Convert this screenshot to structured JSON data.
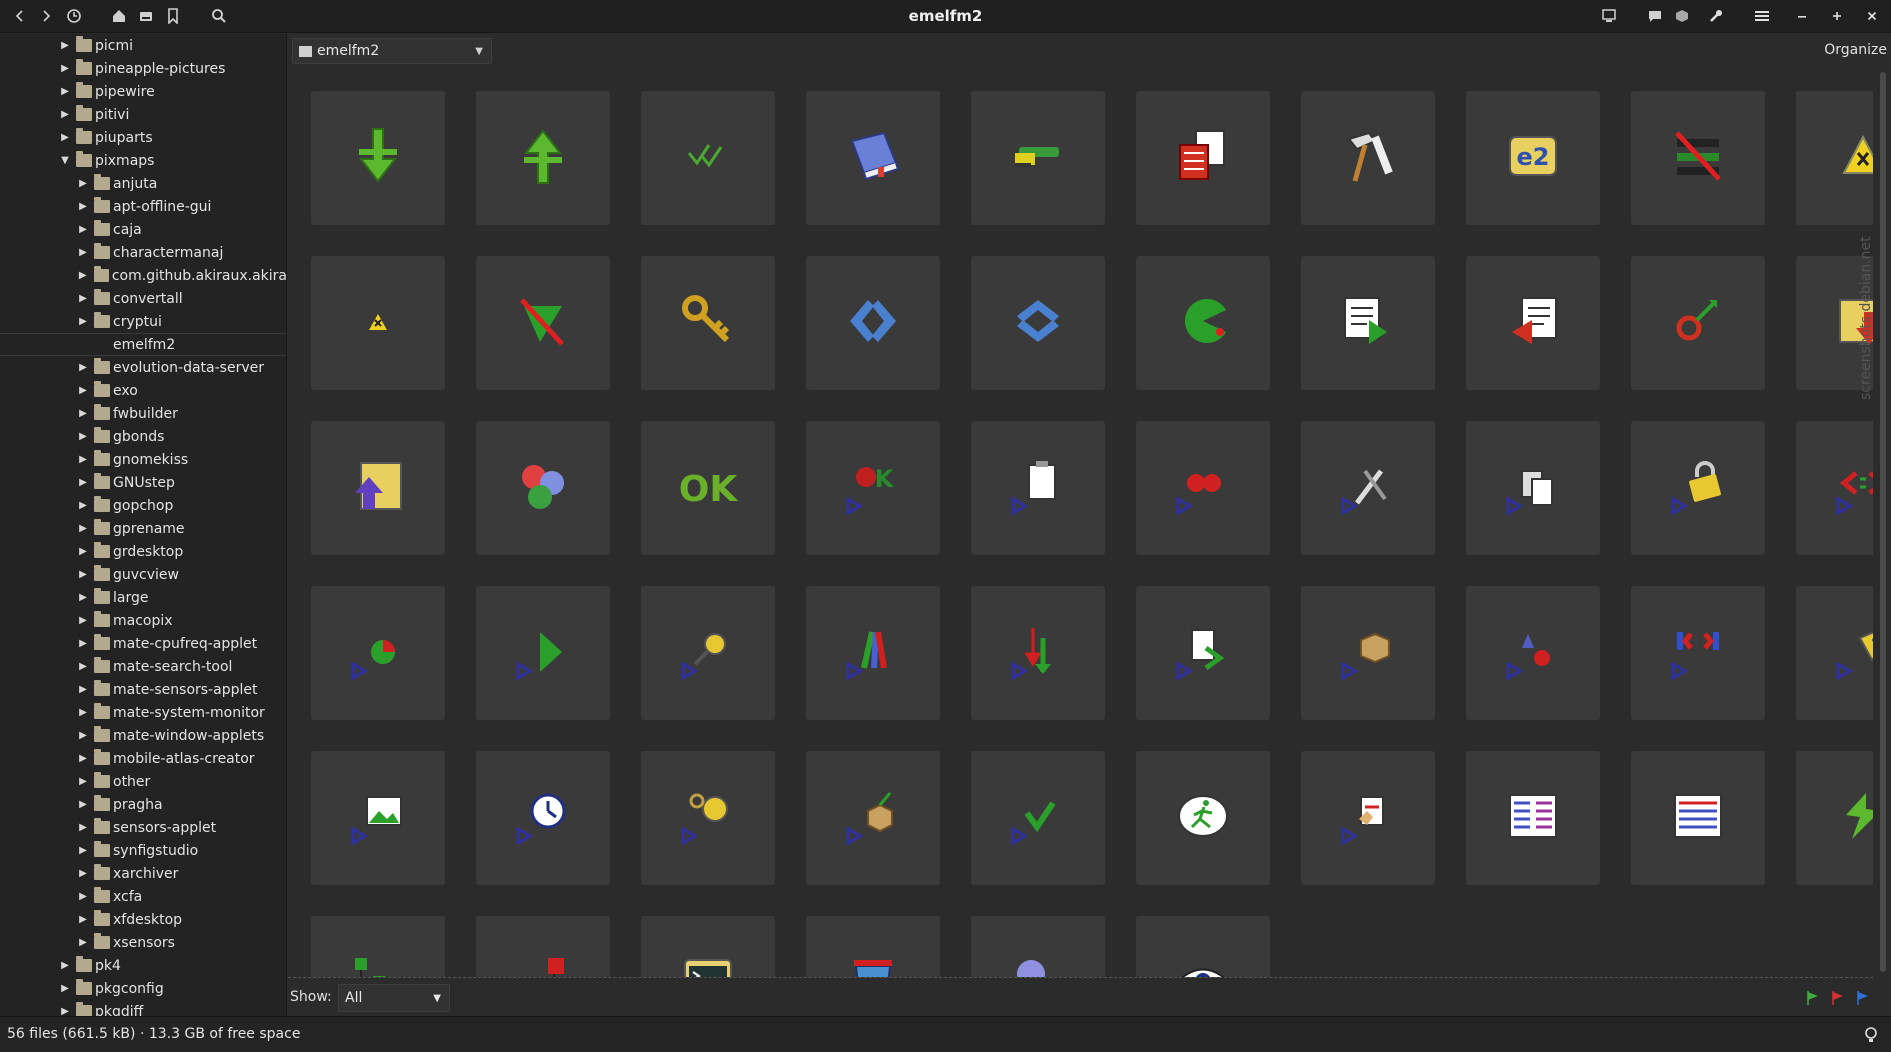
{
  "window": {
    "title": "emelfm2"
  },
  "toolbar": {
    "left_icons": [
      "back-arrow-icon",
      "forward-arrow-icon",
      "history-icon",
      "home-icon",
      "drive-icon",
      "bookmark-icon",
      "search-icon"
    ],
    "right_icons": [
      "monitor-icon",
      "chat-icon",
      "tag-icon",
      "wrench-icon",
      "menu-icon",
      "minimize-icon",
      "maximize-icon",
      "close-icon"
    ]
  },
  "sidebar": {
    "items": [
      {
        "label": "picmi",
        "depth": 0,
        "arrow": "right"
      },
      {
        "label": "pineapple-pictures",
        "depth": 0,
        "arrow": "right"
      },
      {
        "label": "pipewire",
        "depth": 0,
        "arrow": "right"
      },
      {
        "label": "pitivi",
        "depth": 0,
        "arrow": "right"
      },
      {
        "label": "piuparts",
        "depth": 0,
        "arrow": "right"
      },
      {
        "label": "pixmaps",
        "depth": 0,
        "arrow": "down"
      },
      {
        "label": "anjuta",
        "depth": 1,
        "arrow": "right"
      },
      {
        "label": "apt-offline-gui",
        "depth": 1,
        "arrow": "right"
      },
      {
        "label": "caja",
        "depth": 1,
        "arrow": "right"
      },
      {
        "label": "charactermanaj",
        "depth": 1,
        "arrow": "right"
      },
      {
        "label": "com.github.akiraux.akira",
        "depth": 1,
        "arrow": "right"
      },
      {
        "label": "convertall",
        "depth": 1,
        "arrow": "right"
      },
      {
        "label": "cryptui",
        "depth": 1,
        "arrow": "right"
      },
      {
        "label": "emelfm2",
        "depth": 1,
        "arrow": "none",
        "selected": true
      },
      {
        "label": "evolution-data-server",
        "depth": 1,
        "arrow": "right"
      },
      {
        "label": "exo",
        "depth": 1,
        "arrow": "right"
      },
      {
        "label": "fwbuilder",
        "depth": 1,
        "arrow": "right"
      },
      {
        "label": "gbonds",
        "depth": 1,
        "arrow": "right"
      },
      {
        "label": "gnomekiss",
        "depth": 1,
        "arrow": "right"
      },
      {
        "label": "GNUstep",
        "depth": 1,
        "arrow": "right"
      },
      {
        "label": "gopchop",
        "depth": 1,
        "arrow": "right"
      },
      {
        "label": "gprename",
        "depth": 1,
        "arrow": "right"
      },
      {
        "label": "grdesktop",
        "depth": 1,
        "arrow": "right"
      },
      {
        "label": "guvcview",
        "depth": 1,
        "arrow": "right"
      },
      {
        "label": "large",
        "depth": 1,
        "arrow": "right"
      },
      {
        "label": "macopix",
        "depth": 1,
        "arrow": "right"
      },
      {
        "label": "mate-cpufreq-applet",
        "depth": 1,
        "arrow": "right"
      },
      {
        "label": "mate-search-tool",
        "depth": 1,
        "arrow": "right"
      },
      {
        "label": "mate-sensors-applet",
        "depth": 1,
        "arrow": "right"
      },
      {
        "label": "mate-system-monitor",
        "depth": 1,
        "arrow": "right"
      },
      {
        "label": "mate-window-applets",
        "depth": 1,
        "arrow": "right"
      },
      {
        "label": "mobile-atlas-creator",
        "depth": 1,
        "arrow": "right"
      },
      {
        "label": "other",
        "depth": 1,
        "arrow": "right"
      },
      {
        "label": "pragha",
        "depth": 1,
        "arrow": "right"
      },
      {
        "label": "sensors-applet",
        "depth": 1,
        "arrow": "right"
      },
      {
        "label": "synfigstudio",
        "depth": 1,
        "arrow": "right"
      },
      {
        "label": "xarchiver",
        "depth": 1,
        "arrow": "right"
      },
      {
        "label": "xcfa",
        "depth": 1,
        "arrow": "right"
      },
      {
        "label": "xfdesktop",
        "depth": 1,
        "arrow": "right"
      },
      {
        "label": "xsensors",
        "depth": 1,
        "arrow": "right"
      },
      {
        "label": "pk4",
        "depth": 0,
        "arrow": "right"
      },
      {
        "label": "pkgconfig",
        "depth": 0,
        "arrow": "right"
      },
      {
        "label": "pkgdiff",
        "depth": 0,
        "arrow": "right"
      }
    ]
  },
  "location": {
    "path": "emelfm2",
    "organize_label": "Organize"
  },
  "grid": {
    "icons": [
      "green-down-arrow-icon",
      "green-up-arrow-icon",
      "green-checkmarks-icon",
      "blue-book-icon",
      "brush-icon",
      "red-document-copy-icon",
      "hammer-icon",
      "e2-logo-icon",
      "red-strike-lines-icon",
      "yellow-warning-icon",
      "small-warning-icon",
      "green-shape-strike-icon",
      "golden-key-icon",
      "blue-diamond-arrows-icon",
      "blue-chevrons-icon",
      "green-pacman-icon",
      "document-arrow-right-icon",
      "document-arrow-left-icon",
      "red-gear-arrow-icon",
      "yellow-folder-down-icon",
      "yellow-folder-up-icon",
      "theater-masks-icon",
      "green-ok-icon",
      "red-k-icon",
      "clipboard-icon",
      "red-cherries-icon",
      "wrench-screwdriver-icon",
      "copy-documents-icon",
      "yellow-padlock-icon",
      "red-code-arrows-icon",
      "pie-chart-icon",
      "green-play-icon",
      "magnifier-icon",
      "colored-bars-icon",
      "red-green-arrows-icon",
      "document-export-icon",
      "cardboard-box-icon",
      "drop-ball-icon",
      "red-blue-arrows-icon",
      "price-tag-icon",
      "landscape-image-icon",
      "clock-icon",
      "gear-magnifier-icon",
      "package-arrow-icon",
      "green-refresh-icon",
      "running-man-icon",
      "hand-document-icon",
      "two-column-list-icon",
      "multi-column-list-icon",
      "green-lightning-icon",
      "green-tree-connector-icon",
      "red-connector-icon",
      "terminal-icon",
      "trash-bin-icon",
      "face-gear-icon",
      "eye-icon"
    ]
  },
  "filter": {
    "show_label": "Show:",
    "show_value": "All",
    "flags": [
      "green-flag-icon",
      "red-flag-icon",
      "blue-flag-icon"
    ]
  },
  "status": {
    "text": "56 files (661.5  kB)  ·  13.3  GB of free space"
  },
  "watermark": {
    "text": "screenshots.debian.net"
  }
}
